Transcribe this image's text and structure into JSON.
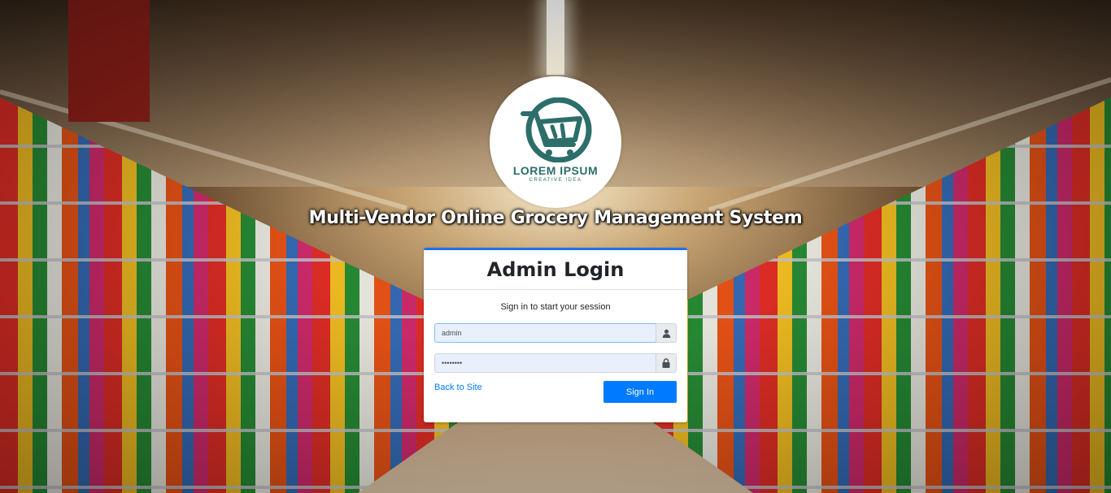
{
  "brand": {
    "logo_text": "LOREM IPSUM",
    "logo_subtext": "CREATIVE IDEA",
    "logo_color": "#2c6e6a"
  },
  "system_title": "Multi-Vendor Online Grocery Management System",
  "login": {
    "title": "Admin Login",
    "message": "Sign in to start your session",
    "username": {
      "value": "admin",
      "icon": "user-icon"
    },
    "password": {
      "value": "••••••••",
      "icon": "lock-icon"
    },
    "back_link": "Back to Site",
    "submit": "Sign In"
  },
  "colors": {
    "primary": "#007bff",
    "card_accent": "#1a73e8",
    "input_autofill_bg": "#e8f0fe"
  }
}
